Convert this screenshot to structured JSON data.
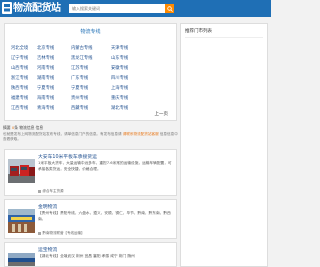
{
  "header": {
    "logo_text": "物流配货站",
    "search_placeholder": "输入搜索关键词",
    "colors": {
      "bar": "#1f6fb5",
      "search_button": "#ff8a00"
    }
  },
  "main": {
    "title": "物流专线",
    "routes": [
      [
        "河北全境",
        "北京专线",
        "内蒙古专线",
        "天津专线"
      ],
      [
        "辽宁专线",
        "吉林专线",
        "黑龙江专线",
        "山东专线"
      ],
      [
        "山西专线",
        "河南专线",
        "江苏专线",
        "安徽专线"
      ],
      [
        "浙江专线",
        "湖南专线",
        "广东专线",
        "四川专线"
      ],
      [
        "陕西专线",
        "宁夏专线",
        "宁夏专线",
        "上海专线"
      ],
      [
        "福建专线",
        "海南专线",
        "贵州专线",
        "重庆专线"
      ],
      [
        "江西专线",
        "青海专线",
        "西藏专线",
        "湖北专线"
      ]
    ],
    "pager": "上一页"
  },
  "notice": {
    "line1_prefix": "摘要 ",
    "line1_highlight": "0",
    "line1_mid": "条 物流信息 信息",
    "line2_text": "也就是发布上网物流配货站发布专线，请单信息门户的信息。有发布信息请 ",
    "line2_highlight": "请联系物流配货站客服",
    "line2_tail": " 信息信息中查看获取。"
  },
  "sidebar": {
    "title": "推荐门市列表"
  },
  "listings": [
    {
      "title": "大安车10米平板车承接货运",
      "desc": "1米平板大货车，大量运输中远多车，重担7.6米常的运输设施，运输车辆配置，可承接各类货运，安全快捷，价格合理。",
      "tag": "综合车主货源"
    },
    {
      "title": "金明物流",
      "desc": "【贵州专线】贵阳专线，六盘水，遵义，安顺，铜仁，毕节，黔南，黔东南，黔西南。",
      "tag": "黔南物流联营【专线运输】"
    },
    {
      "title": "运宝物流",
      "desc": "【湖北专线】全境武汉 荆州 宜昌 襄阳 孝感 咸宁 荆门 随州",
      "tag": ""
    }
  ]
}
